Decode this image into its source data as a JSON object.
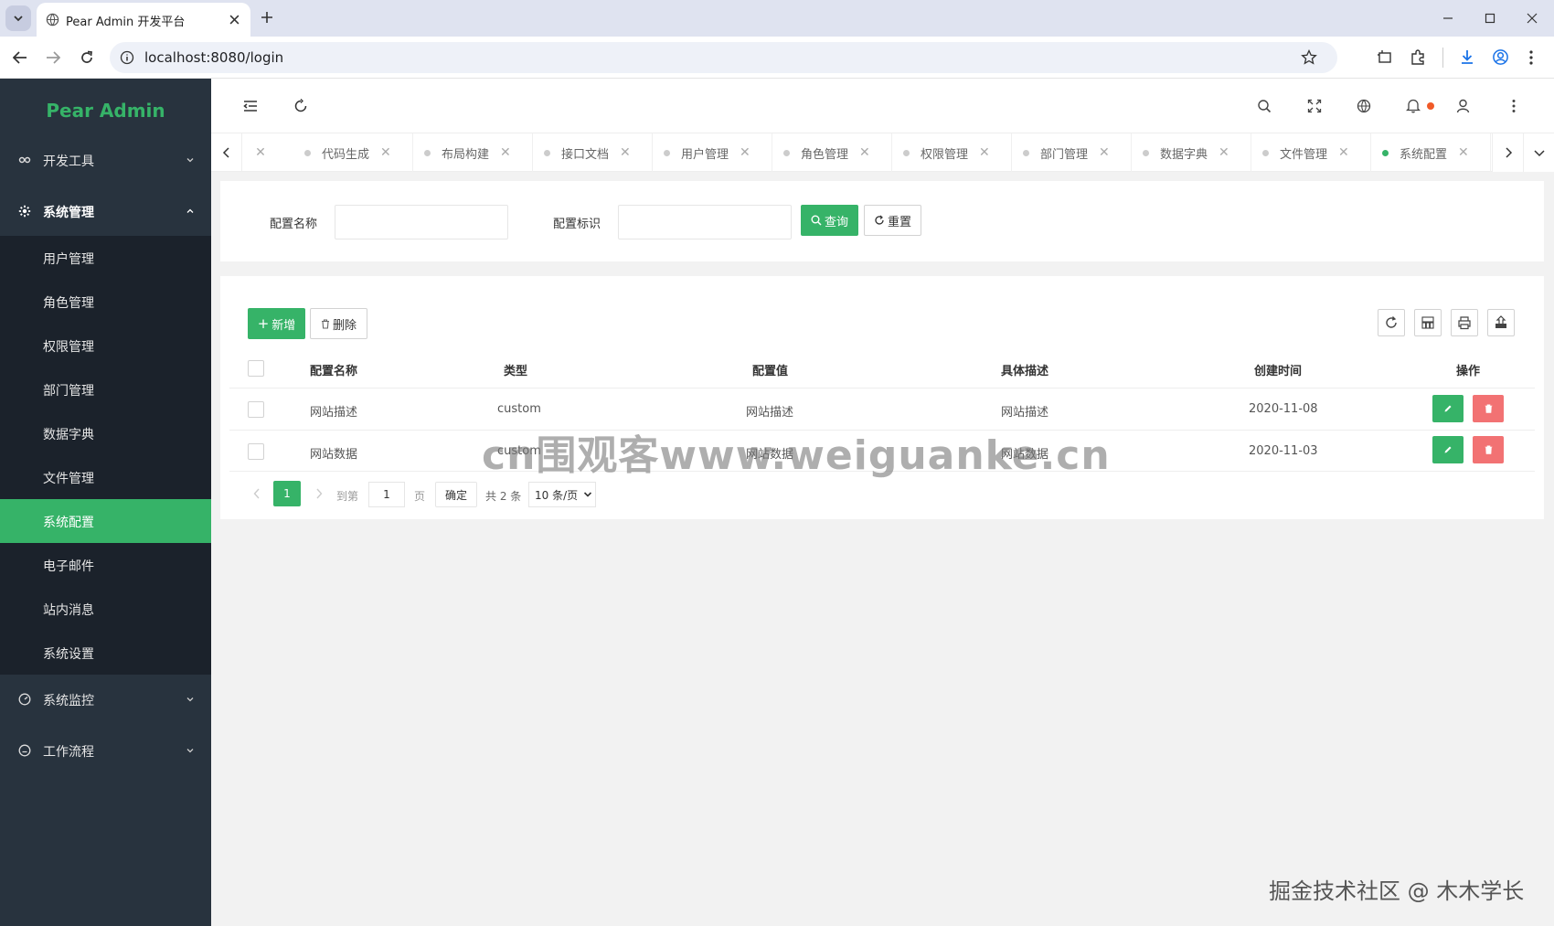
{
  "browser": {
    "tab_title": "Pear Admin 开发平台",
    "url": "localhost:8080/login"
  },
  "sidebar": {
    "logo": "Pear Admin",
    "groups": [
      {
        "label": "开发工具"
      },
      {
        "label": "系统管理"
      },
      {
        "label": "系统监控"
      },
      {
        "label": "工作流程"
      }
    ],
    "items": [
      {
        "label": "用户管理"
      },
      {
        "label": "角色管理"
      },
      {
        "label": "权限管理"
      },
      {
        "label": "部门管理"
      },
      {
        "label": "数据字典"
      },
      {
        "label": "文件管理"
      },
      {
        "label": "系统配置",
        "active": true
      },
      {
        "label": "电子邮件"
      },
      {
        "label": "站内消息"
      },
      {
        "label": "系统设置"
      }
    ]
  },
  "tabs": [
    {
      "label": "代码生成"
    },
    {
      "label": "布局构建"
    },
    {
      "label": "接口文档"
    },
    {
      "label": "用户管理"
    },
    {
      "label": "角色管理"
    },
    {
      "label": "权限管理"
    },
    {
      "label": "部门管理"
    },
    {
      "label": "数据字典"
    },
    {
      "label": "文件管理"
    },
    {
      "label": "系统配置",
      "active": true
    }
  ],
  "search": {
    "name_label": "配置名称",
    "name_value": "",
    "code_label": "配置标识",
    "code_value": "",
    "query_button": "查询",
    "reset_button": "重置"
  },
  "toolbar": {
    "add_button": "新增",
    "delete_button": "删除"
  },
  "table": {
    "columns": [
      "配置名称",
      "类型",
      "配置值",
      "具体描述",
      "创建时间",
      "操作"
    ],
    "rows": [
      {
        "name": "网站描述",
        "type": "custom",
        "value": "网站描述",
        "description": "网站描述",
        "created": "2020-11-08"
      },
      {
        "name": "网站数据",
        "type": "custom",
        "value": "网站数据",
        "description": "网站数据",
        "created": "2020-11-03"
      }
    ]
  },
  "pagination": {
    "current_page": "1",
    "goto_label": "到第",
    "goto_value": "1",
    "page_unit": "页",
    "confirm": "确定",
    "total": "共 2 条",
    "page_size": "10 条/页"
  },
  "overlay": {
    "watermark": "cn围观客www.weiguanke.cn",
    "footer": "掘金技术社区 @ 木木学长"
  },
  "colors": {
    "accent": "#36b368",
    "danger": "#f27273",
    "sidebar_bg": "#28333e",
    "submenu_bg": "#1b222b",
    "notify_dot": "#f05a28"
  }
}
